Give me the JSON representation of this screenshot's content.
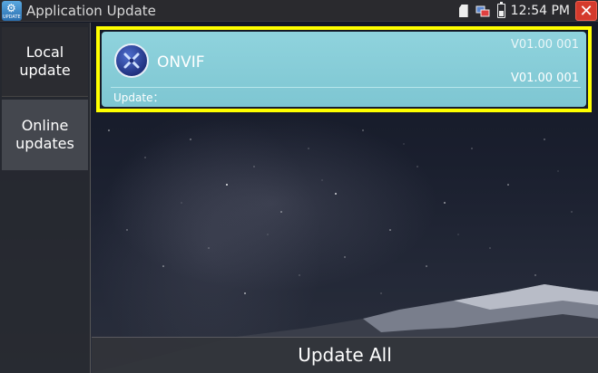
{
  "statusbar": {
    "title": "Application Update",
    "app_icon_label": "UPDATE",
    "time": "12:54 PM",
    "icons": [
      "sd-card-icon",
      "network-icon",
      "battery-icon",
      "close-icon"
    ],
    "close_glyph": "✕"
  },
  "sidebar": {
    "items": [
      {
        "line1": "Local",
        "line2": "update",
        "selected": false
      },
      {
        "line1": "Online",
        "line2": "updates",
        "selected": true
      }
    ]
  },
  "apps": [
    {
      "name": "ONVIF",
      "version_current": "V01.00 001",
      "version_new": "V01.00 001",
      "update_label": "Update："
    }
  ],
  "footer": {
    "update_all_label": "Update All"
  },
  "colors": {
    "card_bg": "#8fd3dd",
    "highlight": "#ffff00",
    "close_red": "#d43a2c"
  }
}
